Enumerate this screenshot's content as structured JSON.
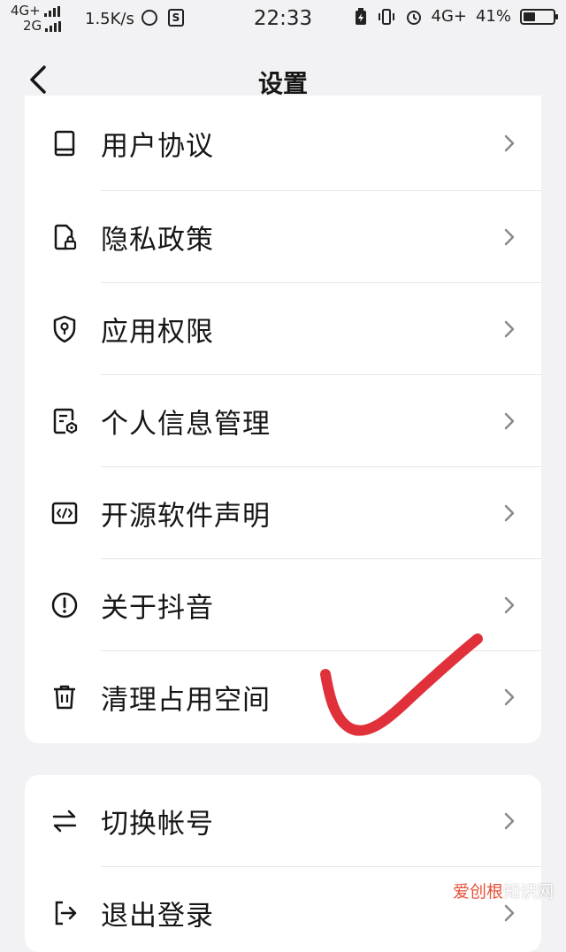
{
  "status_bar": {
    "network_1": "4G+",
    "network_2": "2G",
    "speed": "1.5K/s",
    "time": "22:33",
    "network_3": "4G+",
    "battery": "41%",
    "battery_level": 0.41
  },
  "header": {
    "title": "设置",
    "back_icon": "chevron-left-icon"
  },
  "settings_group_1": [
    {
      "icon": "book-icon",
      "label": "用户协议"
    },
    {
      "icon": "privacy-lock-icon",
      "label": "隐私政策"
    },
    {
      "icon": "shield-icon",
      "label": "应用权限"
    },
    {
      "icon": "personal-info-icon",
      "label": "个人信息管理"
    },
    {
      "icon": "code-icon",
      "label": "开源软件声明"
    },
    {
      "icon": "info-circle-icon",
      "label": "关于抖音"
    },
    {
      "icon": "trash-icon",
      "label": "清理占用空间"
    }
  ],
  "settings_group_2": [
    {
      "icon": "switch-arrows-icon",
      "label": "切换帐号"
    },
    {
      "icon": "logout-icon",
      "label": "退出登录"
    }
  ],
  "annotation": {
    "type": "red-checkmark",
    "color": "#e0303a"
  },
  "watermark": {
    "brand": "爱创根",
    "rest": "知识网"
  }
}
